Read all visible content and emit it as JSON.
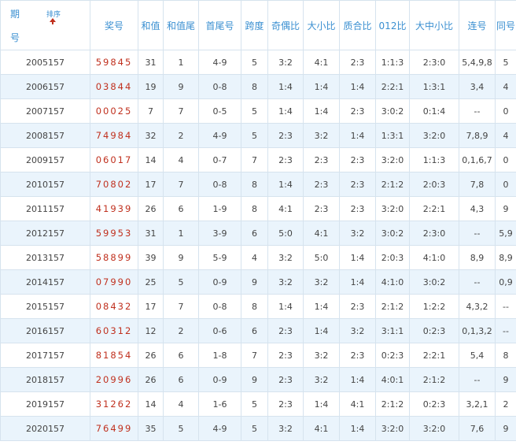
{
  "headers": {
    "period_top": "期",
    "period_bottom": "号",
    "sort": "排序",
    "cols": [
      "奖号",
      "和值",
      "和值尾",
      "首尾号",
      "跨度",
      "奇偶比",
      "大小比",
      "质合比",
      "012比",
      "大中小比",
      "连号",
      "同号"
    ]
  },
  "rows": [
    [
      "2005157",
      "59845",
      "31",
      "1",
      "4-9",
      "5",
      "3:2",
      "4:1",
      "2:3",
      "1:1:3",
      "2:3:0",
      "5,4,9,8",
      "5"
    ],
    [
      "2006157",
      "03844",
      "19",
      "9",
      "0-8",
      "8",
      "1:4",
      "1:4",
      "1:4",
      "2:2:1",
      "1:3:1",
      "3,4",
      "4"
    ],
    [
      "2007157",
      "00025",
      "7",
      "7",
      "0-5",
      "5",
      "1:4",
      "1:4",
      "2:3",
      "3:0:2",
      "0:1:4",
      "--",
      "0"
    ],
    [
      "2008157",
      "74984",
      "32",
      "2",
      "4-9",
      "5",
      "2:3",
      "3:2",
      "1:4",
      "1:3:1",
      "3:2:0",
      "7,8,9",
      "4"
    ],
    [
      "2009157",
      "06017",
      "14",
      "4",
      "0-7",
      "7",
      "2:3",
      "2:3",
      "2:3",
      "3:2:0",
      "1:1:3",
      "0,1,6,7",
      "0"
    ],
    [
      "2010157",
      "70802",
      "17",
      "7",
      "0-8",
      "8",
      "1:4",
      "2:3",
      "2:3",
      "2:1:2",
      "2:0:3",
      "7,8",
      "0"
    ],
    [
      "2011157",
      "41939",
      "26",
      "6",
      "1-9",
      "8",
      "4:1",
      "2:3",
      "2:3",
      "3:2:0",
      "2:2:1",
      "4,3",
      "9"
    ],
    [
      "2012157",
      "59953",
      "31",
      "1",
      "3-9",
      "6",
      "5:0",
      "4:1",
      "3:2",
      "3:0:2",
      "2:3:0",
      "--",
      "5,9"
    ],
    [
      "2013157",
      "58899",
      "39",
      "9",
      "5-9",
      "4",
      "3:2",
      "5:0",
      "1:4",
      "2:0:3",
      "4:1:0",
      "8,9",
      "8,9"
    ],
    [
      "2014157",
      "07990",
      "25",
      "5",
      "0-9",
      "9",
      "3:2",
      "3:2",
      "1:4",
      "4:1:0",
      "3:0:2",
      "--",
      "0,9"
    ],
    [
      "2015157",
      "08432",
      "17",
      "7",
      "0-8",
      "8",
      "1:4",
      "1:4",
      "2:3",
      "2:1:2",
      "1:2:2",
      "4,3,2",
      "--"
    ],
    [
      "2016157",
      "60312",
      "12",
      "2",
      "0-6",
      "6",
      "2:3",
      "1:4",
      "3:2",
      "3:1:1",
      "0:2:3",
      "0,1,3,2",
      "--"
    ],
    [
      "2017157",
      "81854",
      "26",
      "6",
      "1-8",
      "7",
      "2:3",
      "3:2",
      "2:3",
      "0:2:3",
      "2:2:1",
      "5,4",
      "8"
    ],
    [
      "2018157",
      "20996",
      "26",
      "6",
      "0-9",
      "9",
      "2:3",
      "3:2",
      "1:4",
      "4:0:1",
      "2:1:2",
      "--",
      "9"
    ],
    [
      "2019157",
      "31262",
      "14",
      "4",
      "1-6",
      "5",
      "2:3",
      "1:4",
      "4:1",
      "2:1:2",
      "0:2:3",
      "3,2,1",
      "2"
    ],
    [
      "2020157",
      "76499",
      "35",
      "5",
      "4-9",
      "5",
      "3:2",
      "4:1",
      "1:4",
      "3:2:0",
      "3:2:0",
      "7,6",
      "9"
    ]
  ]
}
